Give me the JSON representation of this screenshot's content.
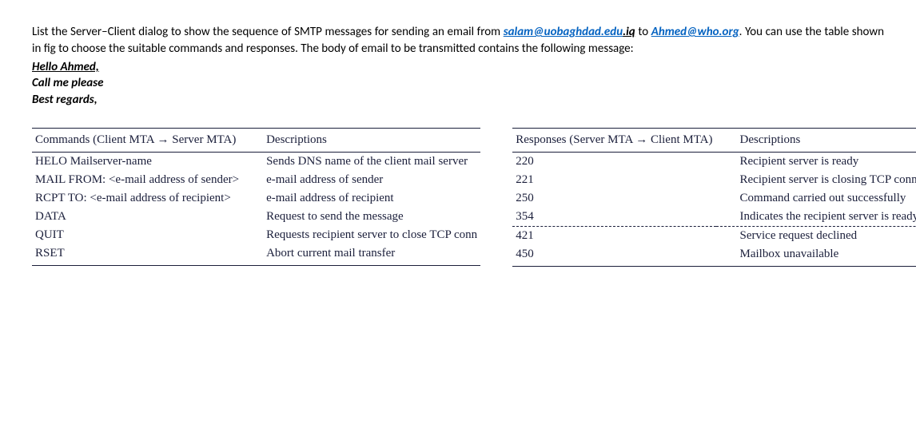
{
  "intro": {
    "p1a": "List the Server–Client dialog to show the sequence of SMTP messages for sending an email from ",
    "email_from": "salam@uobaghdad.edu",
    "iq": ".iq",
    "p1b": " to ",
    "email_to": "Ahmed@who.org",
    "p1c": ". You can use the table shown in fig to choose the suitable commands and responses. The body of email to be transmitted contains the following message:"
  },
  "body": {
    "l1": "Hello Ahmed,",
    "l2": "Call me please",
    "l3": "Best regards,"
  },
  "commands_table": {
    "h1": "Commands (Client MTA → Server MTA)",
    "h2": "Descriptions",
    "rows": [
      {
        "c": "HELO Mailserver-name",
        "d": "Sends DNS name of the client mail server"
      },
      {
        "c": "MAIL FROM: <e-mail address of sender>",
        "d": "e-mail address of sender"
      },
      {
        "c": "RCPT TO: <e-mail address of recipient>",
        "d": "e-mail address of recipient"
      },
      {
        "c": "DATA",
        "d": "Request to send the message"
      },
      {
        "c": "QUIT",
        "d": "Requests recipient server to close TCP conn"
      },
      {
        "c": "RSET",
        "d": "Abort current mail transfer"
      }
    ]
  },
  "responses_table": {
    "h1": "Responses (Server MTA → Client MTA)",
    "h2": "Descriptions",
    "rows": [
      {
        "c": "220",
        "d": "Recipient server is ready"
      },
      {
        "c": "221",
        "d": "Recipient server is closing TCP connection"
      },
      {
        "c": "250",
        "d": "Command carried out successfully"
      },
      {
        "c": "354",
        "d": "Indicates the recipient server is ready to receive",
        "dashed": true
      },
      {
        "c": "421",
        "d": "Service request declined"
      },
      {
        "c": "450",
        "d": "Mailbox unavailable"
      }
    ]
  }
}
